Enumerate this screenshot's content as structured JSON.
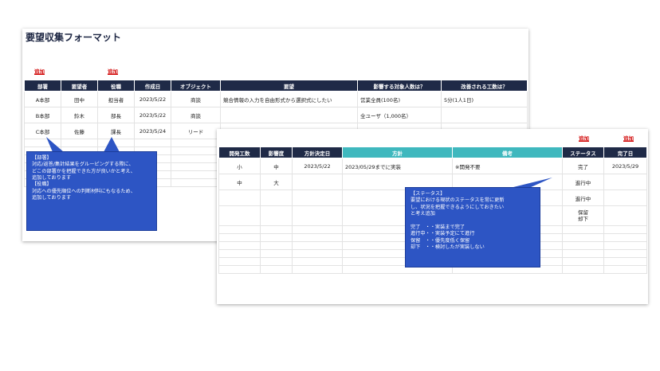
{
  "sheet1": {
    "title": "要望収集フォーマット",
    "add_links": [
      "追加",
      "追加"
    ],
    "headers": [
      "部署",
      "要望者",
      "役職",
      "作成日",
      "オブジェクト",
      "要望",
      "影響する対象人数は？",
      "改善される工数は？"
    ],
    "rows": [
      [
        "A本部",
        "田中",
        "担当者",
        "2023/5/22",
        "商談",
        "競合情報の入力を自由形式から選択式にしたい",
        "営業全員(100名)",
        "5分(1人1日)"
      ],
      [
        "B本部",
        "鈴木",
        "部長",
        "2023/5/22",
        "商談",
        "",
        "全ユーザ（1,000名）",
        ""
      ],
      [
        "C本部",
        "佐藤",
        "課長",
        "2023/5/24",
        "リード",
        "",
        "",
        ""
      ]
    ]
  },
  "sheet2": {
    "add_links": [
      "追加",
      "追加"
    ],
    "headers": [
      "開発工数",
      "影響度",
      "方針決定日",
      "方針",
      "備考",
      "ステータス",
      "完了日"
    ],
    "rows": [
      [
        "小",
        "中",
        "2023/5/22",
        "2023/05/29までに実装",
        "※開発不要",
        "完了",
        "2023/5/29"
      ],
      [
        "中",
        "大",
        "",
        "",
        "",
        "進行中",
        ""
      ],
      [
        "",
        "",
        "",
        "",
        "",
        "進行中",
        ""
      ],
      [
        "",
        "",
        "",
        "",
        "",
        "保留\n却下",
        ""
      ]
    ]
  },
  "callout1": {
    "text": "【部署】\n対応/返答/集計結果をグルーピングする際に、\nどこの部署かを把握できた方が良いかと考え、\n追加しております\n【役職】\n対応への優先順位への判断材料にもなるため、\n追加しております"
  },
  "callout2": {
    "text": "【ステータス】\n要望における現状のステータスを常に更新\nし、状況を把握できるようにしておきたい\nと考え追加\n\n完了　・・実装まで完了\n進行中・・実装予定にて進行\n保留　・・優先度低く保留\n却下　・・検討したが実装しない"
  },
  "colors": {
    "header_navy": "#1f2a47",
    "header_teal": "#3fb8be",
    "callout_blue": "#2d55c4",
    "link_red": "#d00000"
  }
}
